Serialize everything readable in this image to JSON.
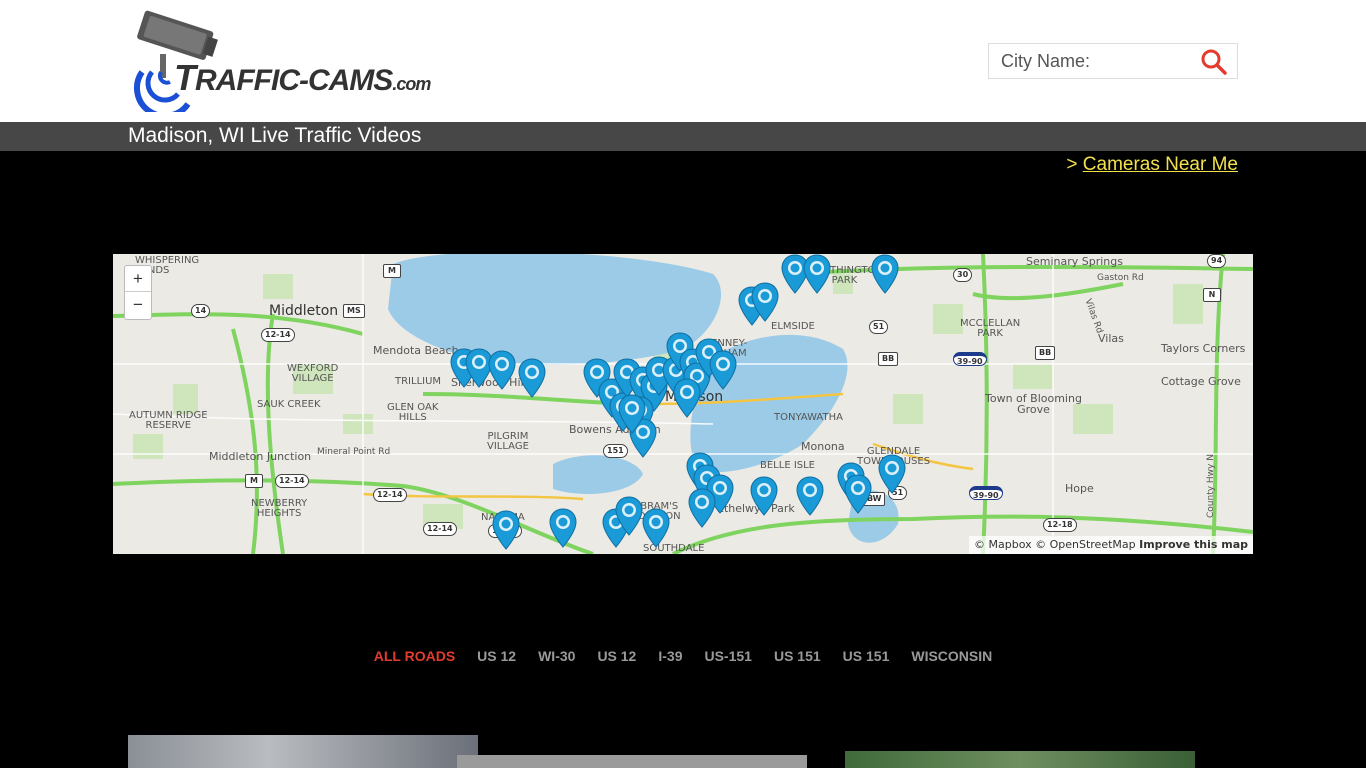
{
  "header": {
    "logo_text_main": "RAFFIC-CAMS",
    "logo_text_t": "T",
    "logo_text_com": ".com",
    "search_placeholder": "City Name:"
  },
  "page": {
    "title": "Madison, WI Live Traffic Videos",
    "near_prefix": "> ",
    "near_link": "Cameras Near Me"
  },
  "map": {
    "zoom_in": "+",
    "zoom_out": "−",
    "attribution_mapbox": "© Mapbox",
    "attribution_osm": "© OpenStreetMap",
    "attribution_improve": "Improve this map",
    "labels": {
      "whispering_winds": "WHISPERING\nWINDS",
      "middleton": "Middleton",
      "mendota_beach": "Mendota Beach",
      "wexford_village": "WEXFORD\nVILLAGE",
      "trillium": "TRILLIUM",
      "sherwood_hills": "Sherwood Hills",
      "sauk_creek": "SAUK CREEK",
      "autumn_ridge": "AUTUMN RIDGE\nRESERVE",
      "glen_oak": "GLEN OAK\nHILLS",
      "pilgrim_village": "PILGRIM\nVILLAGE",
      "bowens_addition": "Bowens Addition",
      "middleton_junction": "Middleton Junction",
      "mineral_point": "Mineral Point Rd",
      "newberry_heights": "NEWBERRY\nHEIGHTS",
      "nakoma": "NAKOMA",
      "abrams_addition": "ABRAM'S\nADDITION",
      "southdale": "SOUTHDALE",
      "madison": "Madison",
      "worthington_park": "WORTHINGTON\nPARK",
      "elmside": "ELMSIDE",
      "tenney_lapham": "TENNEY-\nLAPHAM",
      "tonyawatha": "TONYAWATHA",
      "monona": "Monona",
      "belle_isle": "BELLE ISLE",
      "glendale_townhouses": "GLENDALE\nTOWNHOUSES",
      "ethelwyn_park": "Ethelwyn Park",
      "seminary_springs": "Seminary Springs",
      "gaston_rd": "Gaston Rd",
      "mcclellan_park": "MCCLELLAN\nPARK",
      "vilas": "Vilas",
      "taylors_corners": "Taylors Corners",
      "cottage_grove": "Cottage Grove",
      "town_of_blooming_grove": "Town of Blooming\nGrove",
      "hope": "Hope",
      "vilas_rd": "Vilas Rd",
      "county_hwy_n": "County Hwy N"
    },
    "shields": [
      "M",
      "MS",
      "14",
      "12-14",
      "12-14",
      "12-14",
      "12-14",
      "12-14",
      "M",
      "151",
      "BB",
      "BB",
      "30",
      "51",
      "39-90",
      "39-90",
      "N",
      "94",
      "BW",
      "51",
      "12-18"
    ]
  },
  "filters": [
    "ALL ROADS",
    "US 12",
    "WI-30",
    "US 12",
    "I-39",
    "US-151",
    "US 151",
    "US 151",
    "WISCONSIN"
  ],
  "colors": {
    "accent_red": "#e33b2e",
    "link_yellow": "#f2e14a",
    "marker_blue": "#1a9ad6",
    "titlebar_gray": "#474747"
  }
}
